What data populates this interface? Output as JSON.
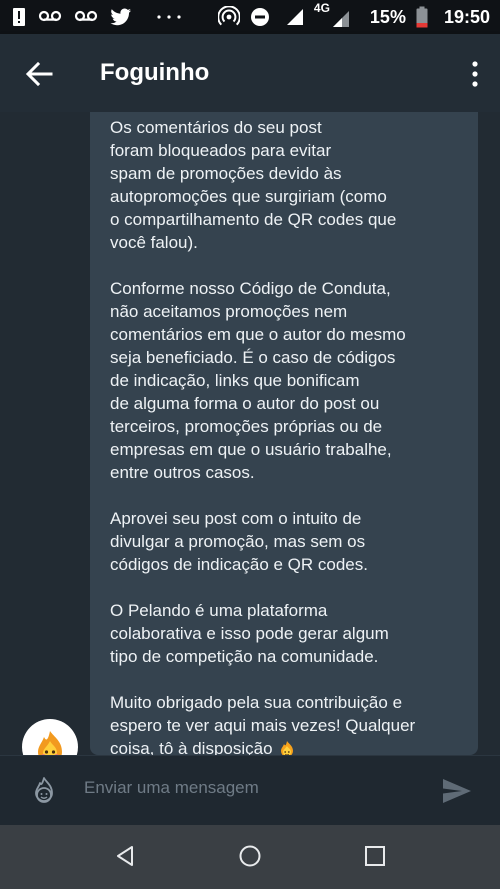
{
  "status_bar": {
    "network": "4G",
    "battery": "15%",
    "time": "19:50",
    "icons": [
      "alert-icon",
      "voicemail-icon",
      "voicemail-icon",
      "twitter-icon",
      "more-icon",
      "hotspot-icon",
      "dnd-icon",
      "signal-icon",
      "signal-icon",
      "battery-icon"
    ]
  },
  "toolbar": {
    "title": "Foguinho"
  },
  "message": {
    "paragraphs": [
      "Os comentários do seu post\nforam bloqueados para evitar\nspam de promoções devido às\nautopromoções que surgiriam (como\no compartilhamento de QR codes que\nvocê falou).",
      "Conforme nosso Código de Conduta,\nnão aceitamos promoções nem\ncomentários em que o autor do mesmo\nseja beneficiado. É o caso de códigos\nde indicação, links que bonificam\nde alguma forma o autor do post ou\nterceiros, promoções próprias ou de\nempresas em que o usuário trabalhe,\nentre outros casos.",
      "Aprovei seu post com o intuito de\ndivulgar a promoção, mas sem os\ncódigos de indicação e QR codes.",
      "O Pelando é uma plataforma\ncolaborativa e isso pode gerar algum\ntipo de competição na comunidade.",
      "Muito obrigado pela sua contribuição e\nespero te ver aqui mais vezes! Qualquer\ncoisa, tô à disposição"
    ],
    "trailing_emoji": "fire-face-emoji"
  },
  "input": {
    "placeholder": "Enviar uma mensagem"
  },
  "colors": {
    "status_bar": "#0f1216",
    "toolbar": "#232d36",
    "background": "#222b33",
    "bubble": "#35434f",
    "input_bar": "#1f2830",
    "nav_bar": "#3a3f44"
  }
}
